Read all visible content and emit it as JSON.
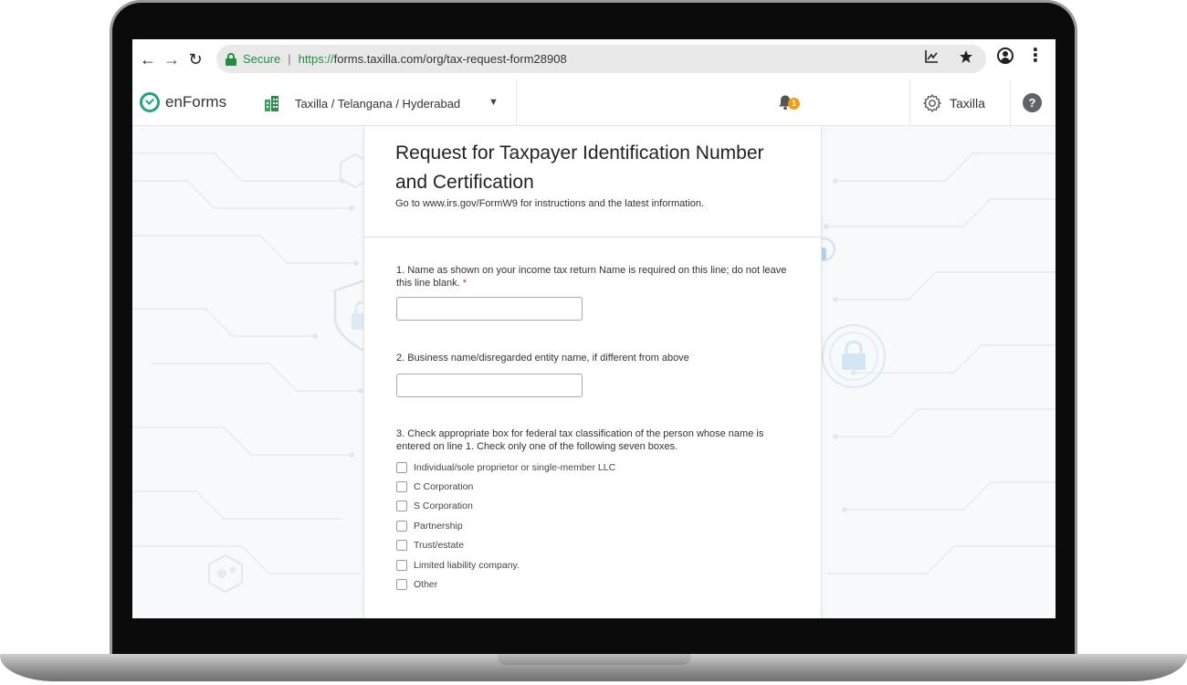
{
  "browser": {
    "secure_label": "Secure",
    "separator": "|",
    "url_protocol": "https://",
    "url_rest": "forms.taxilla.com/org/tax-request-form28908"
  },
  "app": {
    "brand_name": "enForms",
    "org_path": "Taxilla / Telangana  / Hyderabad",
    "notification_count": "1",
    "settings_label": "Taxilla",
    "help_label": "?"
  },
  "form": {
    "title": "Request for Taxpayer Identification Number and Certification",
    "subtitle": "Go to www.irs.gov/FormW9 for instructions and the latest information.",
    "q1_label": "1. Name as shown on your income tax return Name is required on this line; do not leave this line blank.",
    "required_mark": "*",
    "q1_value": "",
    "q2_label": "2. Business name/disregarded entity name, if different from above",
    "q2_value": "",
    "q3_label": "3. Check appropriate box for federal tax classification of the person whose name is entered on line 1. Check only one of the following seven boxes.",
    "q3_options": [
      "Individual/sole proprietor or single-member LLC",
      "C Corporation",
      "S Corporation",
      "Partnership",
      "Trust/estate",
      "Limited liability company.",
      "Other"
    ]
  },
  "colors": {
    "secure_green": "#1e8e3e",
    "brand_green": "#22a57a",
    "badge_orange": "#f39c12",
    "required_red": "#d93025"
  }
}
